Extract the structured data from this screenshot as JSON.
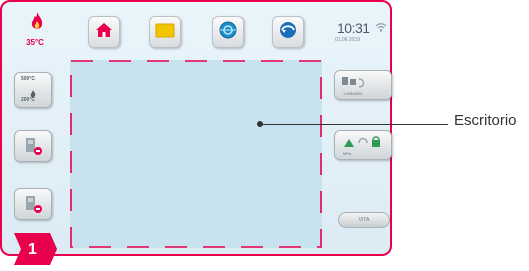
{
  "status": {
    "temperature": "35°C",
    "time": "10:31",
    "date": "01.06.2019"
  },
  "toolbar": {
    "icons": [
      "home-icon",
      "folder-icon",
      "globe-icon",
      "update-icon"
    ]
  },
  "left_buttons": {
    "temp_top": "500°C",
    "temp_bottom": "200°C"
  },
  "right_buttons": {
    "vacuum_label": "1 MIN/MIN",
    "pressure_label": "MPa",
    "vita_label": "VITA"
  },
  "colors": {
    "accent": "#e8004c",
    "desktop": "#c9e2ef"
  },
  "callout": {
    "number": "1",
    "label": "Escritorio"
  }
}
